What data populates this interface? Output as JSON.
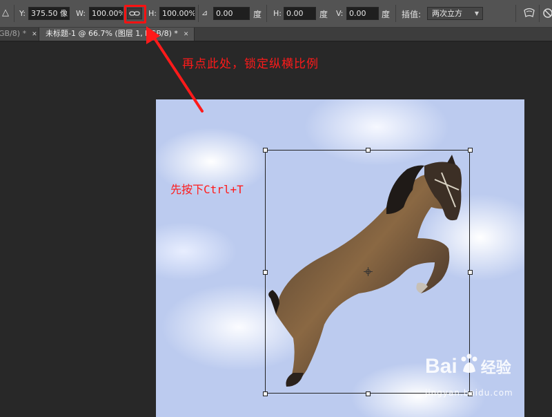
{
  "options_bar": {
    "y_label": "Y:",
    "y_value": "375.50 像",
    "w_label": "W:",
    "w_value": "100.00%",
    "h_label": "H:",
    "h_value": "100.00%",
    "angle_value": "0.00",
    "angle_unit": "度",
    "hskew_label": "H:",
    "hskew_value": "0.00",
    "hskew_unit": "度",
    "vskew_label": "V:",
    "vskew_value": "0.00",
    "vskew_unit": "度",
    "interp_label": "插值:",
    "interp_value": "两次立方"
  },
  "tabs": [
    {
      "label": "GB/8) *"
    },
    {
      "label": "未标题-1 @ 66.7% (图层 1, RGB/8) *"
    }
  ],
  "annotations": {
    "top": "再点此处，锁定纵横比例",
    "left": "先按下Ctrl+T"
  },
  "watermark": {
    "brand": "Bai",
    "brand_suffix": "经验",
    "url": "jingyan.baidu.com"
  },
  "colors": {
    "annotation": "#ff1a1a",
    "toolbar": "#535353",
    "workspace": "#282828",
    "sky": "#bccbef"
  }
}
